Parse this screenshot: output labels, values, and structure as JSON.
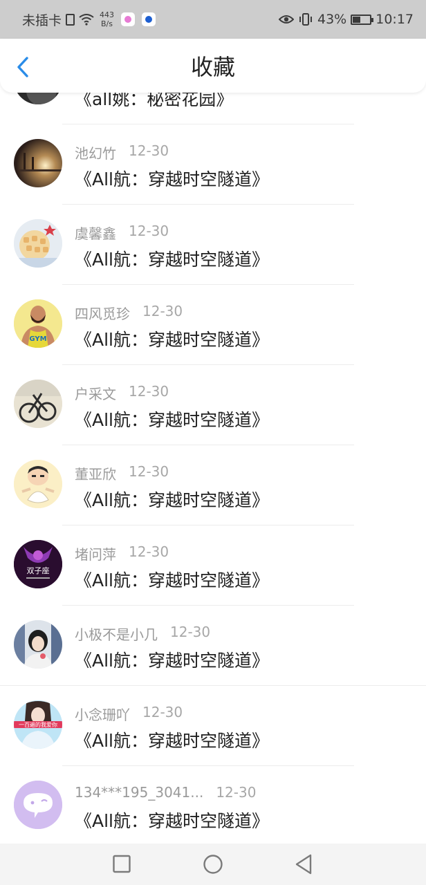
{
  "status_bar": {
    "carrier": "未插卡",
    "net_speed_value": "443",
    "net_speed_unit": "B/s",
    "battery_percent": "43%",
    "battery_level": 0.43,
    "time": "10:17"
  },
  "header": {
    "title": "收藏"
  },
  "items": [
    {
      "name": "",
      "date": "",
      "title": "《all姚：秘密花园》"
    },
    {
      "name": "池幻竹",
      "date": "12-30",
      "title": "《All航：穿越时空隧道》"
    },
    {
      "name": "虞馨鑫",
      "date": "12-30",
      "title": "《All航：穿越时空隧道》"
    },
    {
      "name": "四风觅珍",
      "date": "12-30",
      "title": "《All航：穿越时空隧道》"
    },
    {
      "name": "户采文",
      "date": "12-30",
      "title": "《All航：穿越时空隧道》"
    },
    {
      "name": "董亚欣",
      "date": "12-30",
      "title": "《All航：穿越时空隧道》"
    },
    {
      "name": "堵问萍",
      "date": "12-30",
      "title": "《All航：穿越时空隧道》"
    },
    {
      "name": "小极不是小几",
      "date": "12-30",
      "title": "《All航：穿越时空隧道》"
    },
    {
      "name": "小念珊吖",
      "date": "12-30",
      "title": "《All航：穿越时空隧道》"
    },
    {
      "name": "134***195_3041...",
      "date": "12-30",
      "title": "《All航：穿越时空隧道》"
    }
  ],
  "avatar_texts": {
    "gym": "GYM",
    "twins": "双子座",
    "banner": "一百遍的我爱你"
  },
  "colors": {
    "accent": "#2a8ce8",
    "status_bar_bg": "#cdcdcd",
    "name_gray": "#9a9a9a",
    "title_text": "#1f1f1f"
  },
  "icons": {
    "back": "chevron-left-icon",
    "home": "circle-home-icon",
    "recents": "square-recents-icon",
    "nav_back": "triangle-back-icon"
  }
}
